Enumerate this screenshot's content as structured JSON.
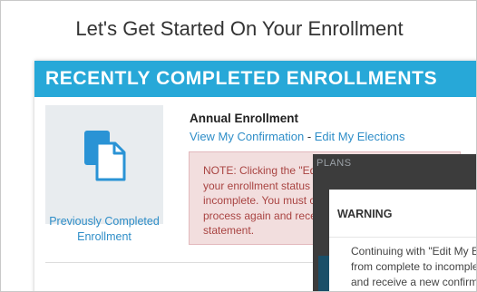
{
  "page": {
    "title": "Let's Get Started On Your Enrollment"
  },
  "section": {
    "header": "RECENTLY COMPLETED ENROLLMENTS"
  },
  "tile": {
    "label_line1": "Previously Completed",
    "label_line2": "Enrollment",
    "icon": "documents-icon",
    "icon_color": "#2a93d5"
  },
  "enrollment": {
    "title": "Annual Enrollment",
    "link_confirmation": "View My Confirmation",
    "link_separator": " - ",
    "link_edit": "Edit My Elections"
  },
  "note": {
    "lines": [
      "NOTE: Clicking the \"Edit",
      "your enrollment status to",
      "incomplete. You must co",
      "process again and receiv",
      "statement."
    ]
  },
  "background_panel": {
    "title": "PLANS"
  },
  "modal": {
    "title": "WARNING",
    "body_lines": [
      "Continuing with \"Edit My E",
      "from complete to incomple",
      "and receive a new confirm"
    ]
  },
  "colors": {
    "header_bg": "#27a8d8",
    "link": "#2f8ec8",
    "note_bg": "#f2dede",
    "note_text": "#a94442",
    "overlay": "#3c3c3c"
  }
}
